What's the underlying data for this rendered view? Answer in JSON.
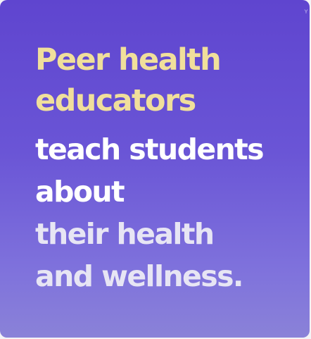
{
  "slide": {
    "headline": [
      "Peer health",
      "educators"
    ],
    "body": [
      "teach students",
      "about",
      "their health",
      "and wellness."
    ]
  },
  "colors": {
    "background": "#6a55d6",
    "headline": "#f0df9b",
    "body": "#ffffff"
  }
}
